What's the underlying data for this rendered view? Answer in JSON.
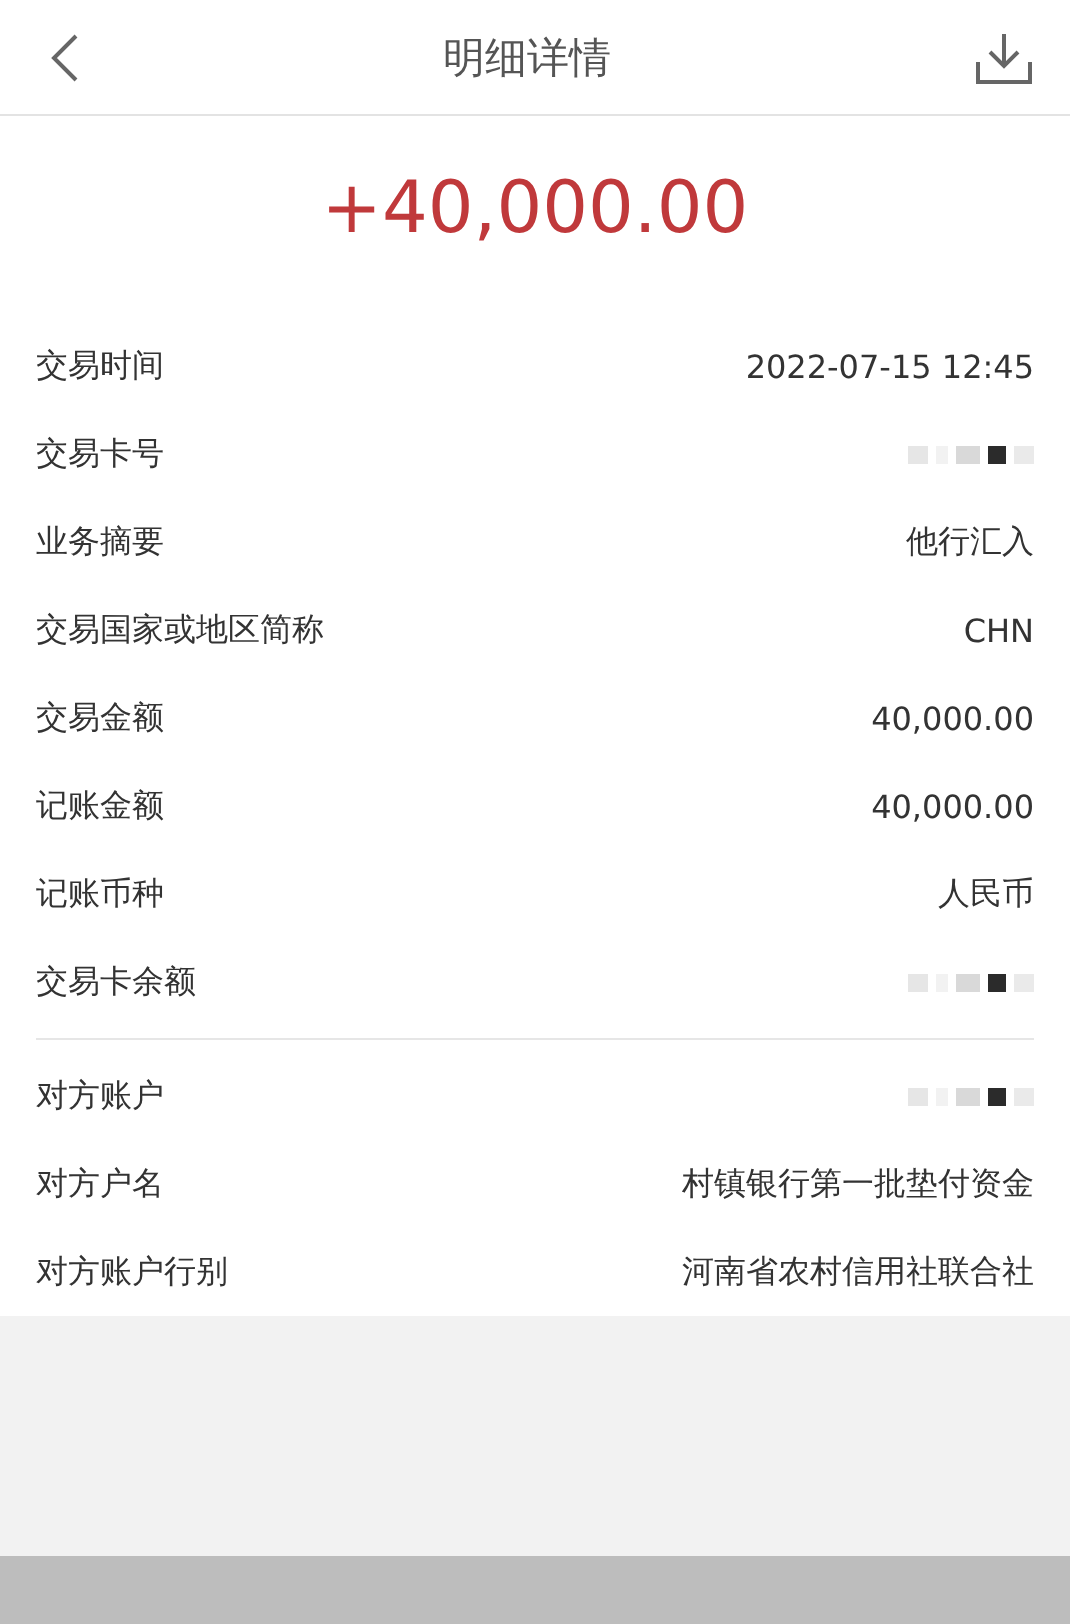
{
  "header": {
    "title": "明细详情"
  },
  "amount": "+40,000.00",
  "sections": [
    {
      "rows": [
        {
          "label": "交易时间",
          "kind": "text",
          "value": "2022-07-15 12:45"
        },
        {
          "label": "交易卡号",
          "kind": "masked"
        },
        {
          "label": "业务摘要",
          "kind": "text",
          "value": "他行汇入"
        },
        {
          "label": "交易国家或地区简称",
          "kind": "text",
          "value": "CHN"
        },
        {
          "label": "交易金额",
          "kind": "text",
          "value": "40,000.00"
        },
        {
          "label": "记账金额",
          "kind": "text",
          "value": "40,000.00"
        },
        {
          "label": "记账币种",
          "kind": "text",
          "value": "人民币"
        },
        {
          "label": "交易卡余额",
          "kind": "masked"
        }
      ]
    },
    {
      "rows": [
        {
          "label": "对方账户",
          "kind": "masked"
        },
        {
          "label": "对方户名",
          "kind": "text",
          "value": "村镇银行第一批垫付资金"
        },
        {
          "label": "对方账户行别",
          "kind": "text",
          "value": "河南省农村信用社联合社"
        }
      ]
    }
  ]
}
